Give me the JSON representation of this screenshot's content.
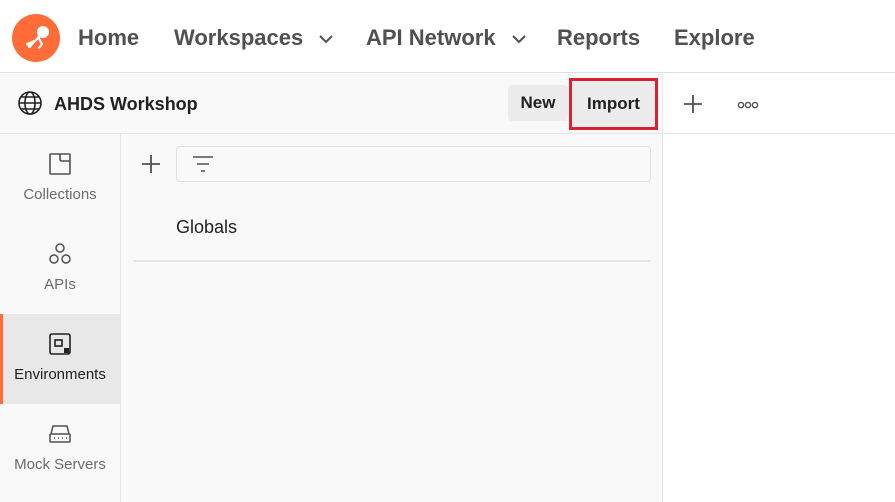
{
  "nav": {
    "home": "Home",
    "workspaces": "Workspaces",
    "api_network": "API Network",
    "reports": "Reports",
    "explore": "Explore"
  },
  "workspace": {
    "title": "AHDS Workshop",
    "new_label": "New",
    "import_label": "Import"
  },
  "sidebar": {
    "items": [
      {
        "label": "Collections",
        "icon": "collections-icon"
      },
      {
        "label": "APIs",
        "icon": "apis-icon"
      },
      {
        "label": "Environments",
        "icon": "environments-icon",
        "active": true
      },
      {
        "label": "Mock Servers",
        "icon": "mock-servers-icon"
      }
    ]
  },
  "panel": {
    "items": [
      "Globals"
    ]
  },
  "colors": {
    "accent": "#ff6c37",
    "highlight": "#d9232e"
  }
}
